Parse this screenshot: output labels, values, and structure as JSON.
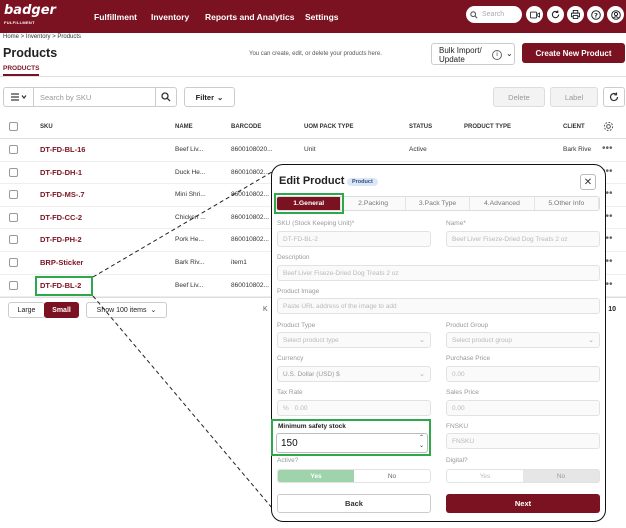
{
  "app": {
    "logo": "badger",
    "logo_sub": "FULFILLMENT",
    "nav": [
      "Fulfillment",
      "Inventory",
      "Reports and Analytics",
      "Settings"
    ],
    "search_placeholder": "Search"
  },
  "breadcrumb": "Home > Inventory > Products",
  "page": {
    "title": "Products",
    "tab": "PRODUCTS",
    "hint": "You can create, edit, or delete your products here.",
    "bulk_label_1": "Bulk Import/",
    "bulk_label_2": "Update",
    "create_label": "Create New Product"
  },
  "toolbar": {
    "search_placeholder": "Search by SKU",
    "filter_label": "Filter",
    "delete_label": "Delete",
    "label_label": "Label"
  },
  "table": {
    "headers": [
      "SKU",
      "NAME",
      "BARCODE",
      "UOM PACK TYPE",
      "STATUS",
      "PRODUCT TYPE",
      "CLIENT"
    ],
    "rows": [
      {
        "sku": "DT-FD-BL-16",
        "name": "Beef Liv...",
        "barcode": "8600108020...",
        "uom": "Unit",
        "status": "Active",
        "client": "Bark Rive"
      },
      {
        "sku": "DT-FD-DH-1",
        "name": "Duck He...",
        "barcode": "860010802...",
        "uom": "",
        "status": "",
        "client": ""
      },
      {
        "sku": "DT-FD-MS-.7",
        "name": "Mini Shri...",
        "barcode": "860010802...",
        "uom": "",
        "status": "",
        "client": ""
      },
      {
        "sku": "DT-FD-CC-2",
        "name": "Chicken ...",
        "barcode": "860010802...",
        "uom": "",
        "status": "",
        "client": ""
      },
      {
        "sku": "DT-FD-PH-2",
        "name": "Pork He...",
        "barcode": "860010802...",
        "uom": "",
        "status": "",
        "client": ""
      },
      {
        "sku": "BRP-Sticker",
        "name": "Bark Riv...",
        "barcode": "item1",
        "uom": "",
        "status": "",
        "client": ""
      },
      {
        "sku": "DT-FD-BL-2",
        "name": "Beef Liv...",
        "barcode": "860010802...",
        "uom": "",
        "status": "",
        "client": ""
      }
    ]
  },
  "footer": {
    "large_label": "Large",
    "small_label": "Small",
    "show_label": "Show 100 items",
    "total_label": "l: 10"
  },
  "modal": {
    "title": "Edit Product",
    "badge": "Product",
    "tabs": [
      "1.General",
      "2.Packing",
      "3.Pack Type",
      "4.Advanced",
      "5.Other Info"
    ],
    "sku_label": "SKU (Stock Keeping Unit)*",
    "sku_value": "DT-FD-BL-2",
    "name_label": "Name*",
    "name_value": "Beef Liver Fiseze-Dried Dog Treats 2 oz",
    "desc_label": "Description",
    "desc_value": "Beef Liver Fiseze-Dried Dog Treats 2 oz",
    "image_label": "Product Image",
    "image_value": "Paste URL address of the image to add",
    "ptype_label": "Product Type",
    "ptype_value": "Select product type",
    "pgroup_label": "Product Group",
    "pgroup_value": "Select product group",
    "currency_label": "Currency",
    "currency_value": "U.S. Dollar (USD) $",
    "purchase_label": "Purchase Price",
    "purchase_value": "0.00",
    "tax_label": "Tax Rate",
    "tax_value": "0.00",
    "tax_prefix": "%",
    "sales_label": "Sales Price",
    "sales_value": "0.00",
    "safety_label": "Minimum safety stock",
    "safety_value": "150",
    "fnsku_label": "FNSKU",
    "fnsku_value": "FNSKU",
    "active_label": "Active?",
    "digital_label": "Digital?",
    "yes": "Yes",
    "no": "No",
    "back_label": "Back",
    "next_label": "Next"
  },
  "colors": {
    "brand": "#7b1221",
    "highlight": "#2ea84a"
  }
}
